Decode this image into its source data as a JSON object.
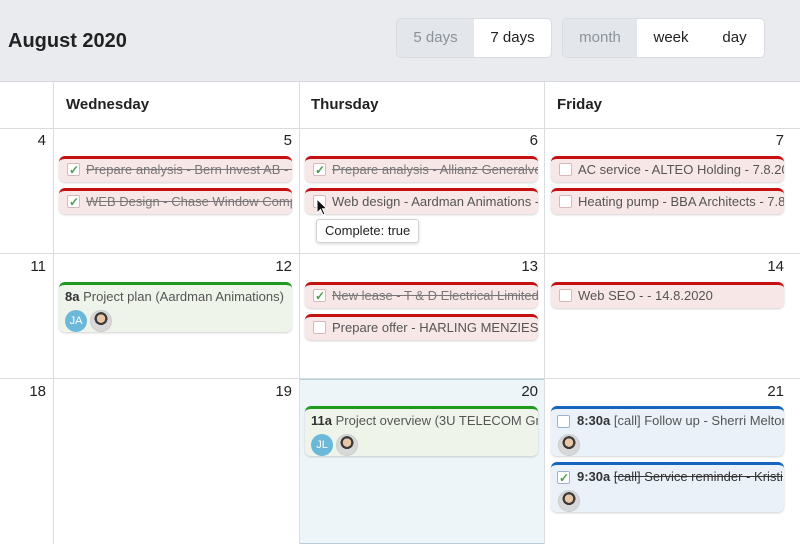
{
  "header": {
    "title": "August 2020",
    "day_span": {
      "options": [
        "5 days",
        "7 days"
      ],
      "selected": "7 days"
    },
    "view": {
      "options": [
        "month",
        "week",
        "day"
      ],
      "selected": "month"
    }
  },
  "columns": [
    "Wednesday",
    "Thursday",
    "Friday"
  ],
  "weeks": [
    {
      "week_date": "4",
      "dates": [
        "5",
        "6",
        "7"
      ]
    },
    {
      "week_date": "11",
      "dates": [
        "12",
        "13",
        "14"
      ]
    },
    {
      "week_date": "18",
      "dates": [
        "19",
        "20",
        "21"
      ]
    }
  ],
  "events": {
    "wed5": [
      {
        "title": "Prepare analysis - Bern Invest AB - 5",
        "done": true
      },
      {
        "title": "WEB Design - Chase Window Comp",
        "done": true
      }
    ],
    "thu6": [
      {
        "title": "Prepare analysis - Allianz Generalve",
        "done": true
      },
      {
        "title": "Web design - Aardman Animations -",
        "done": false
      }
    ],
    "fri7": [
      {
        "title": "AC service - ALTEO Holding - 7.8.20",
        "done": false
      },
      {
        "title": "Heating pump - BBA Architects - 7.8",
        "done": false
      }
    ],
    "wed12": {
      "time": "8a",
      "title": "Project plan (Aardman Animations)",
      "initials": "JA"
    },
    "thu13": [
      {
        "title": "New lease - T & D Electrical Limited",
        "done": true
      },
      {
        "title": "Prepare offer - HARLING MENZIES E",
        "done": false
      }
    ],
    "fri14": [
      {
        "title": "Web SEO - - 14.8.2020",
        "done": false
      }
    ],
    "thu20": {
      "time": "11a",
      "title": "Project overview (3U TELECOM Gmb",
      "initials": "JL"
    },
    "fri21": [
      {
        "time": "8:30a",
        "title": "[call] Follow up - Sherri Meltor",
        "done": false
      },
      {
        "time": "9:30a",
        "title": "[call] Service reminder - Kristi",
        "done": true
      }
    ]
  },
  "tooltip": "Complete: true",
  "colors": {
    "task_border": "#c41010",
    "meeting_border": "#1e9a1e",
    "call_border": "#1565c0",
    "today_bg": "#eef5f9"
  }
}
